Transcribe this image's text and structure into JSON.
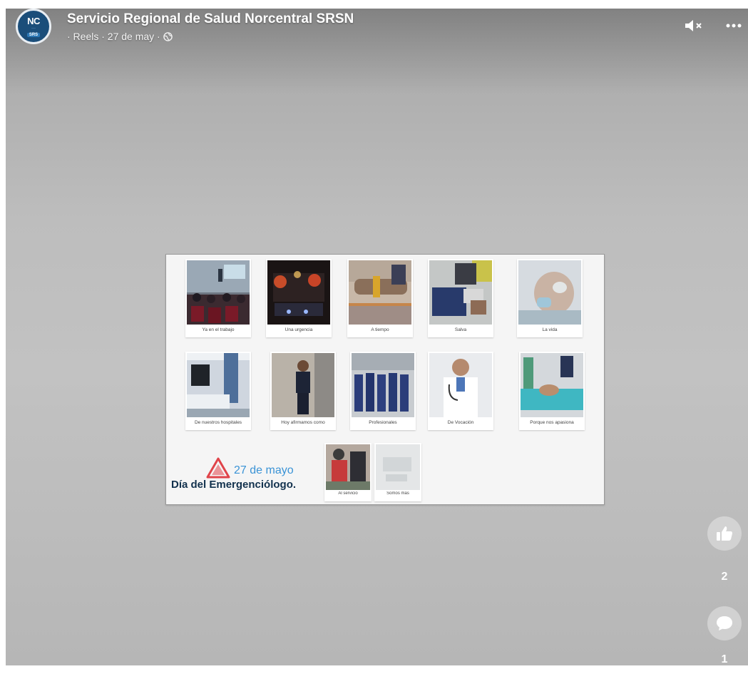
{
  "header": {
    "page_name": "Servicio Regional de Salud Norcentral SRSN",
    "meta": "· Reels · 27 de may ·",
    "avatar": {
      "logo_main": "NC",
      "logo_sub": "···",
      "logo_badge": "SRS"
    }
  },
  "video": {
    "cards_row1": [
      {
        "caption": "Ya en el trabajo"
      },
      {
        "caption": "Una urgencia"
      },
      {
        "caption": "A tiempo"
      },
      {
        "caption": "Salva"
      },
      {
        "caption": "La vida"
      }
    ],
    "cards_row2": [
      {
        "caption": "De nuestros hospitales"
      },
      {
        "caption": "Hoy afirmamos como"
      },
      {
        "caption": "Profesionales"
      },
      {
        "caption": "De Vocación"
      },
      {
        "caption": "Porque nos apasiona"
      }
    ],
    "cards_row3": [
      {
        "caption": "Al servicio"
      },
      {
        "caption": "Somos más"
      }
    ],
    "brand_date": "27 de mayo",
    "brand_title": "Día del Emergenciólogo."
  },
  "actions": {
    "like_count": "2",
    "comment_count": "1"
  },
  "colors": {
    "brand_blue": "#3a93d6",
    "brand_navy": "#12314d",
    "brand_red": "#e0444a"
  }
}
